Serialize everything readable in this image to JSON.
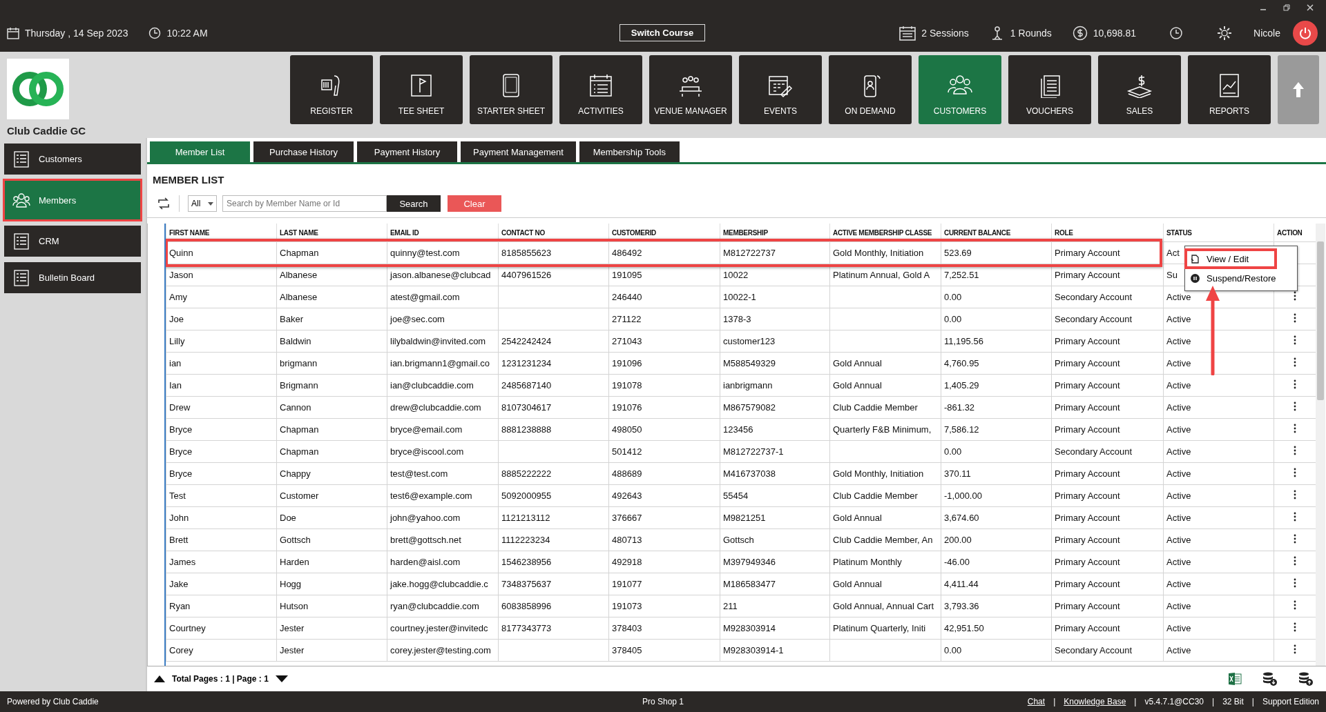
{
  "top_bar": {
    "date": "Thursday ,  14 Sep 2023",
    "time": "10:22 AM",
    "switch_button": "Switch Course",
    "sessions": "2 Sessions",
    "rounds": "1 Rounds",
    "balance": "10,698.81",
    "user": "Nicole"
  },
  "club": {
    "name": "Club Caddie GC"
  },
  "nav_tiles": [
    {
      "label": "REGISTER",
      "selected": false
    },
    {
      "label": "TEE SHEET",
      "selected": false
    },
    {
      "label": "STARTER SHEET",
      "selected": false
    },
    {
      "label": "ACTIVITIES",
      "selected": false
    },
    {
      "label": "VENUE MANAGER",
      "selected": false
    },
    {
      "label": "EVENTS",
      "selected": false
    },
    {
      "label": "ON DEMAND",
      "selected": false
    },
    {
      "label": "CUSTOMERS",
      "selected": true
    },
    {
      "label": "VOUCHERS",
      "selected": false
    },
    {
      "label": "SALES",
      "selected": false
    },
    {
      "label": "REPORTS",
      "selected": false
    }
  ],
  "sidebar": {
    "items": [
      {
        "label": "Customers",
        "selected": false,
        "highlighted": false
      },
      {
        "label": "Members",
        "selected": true,
        "highlighted": true
      },
      {
        "label": "CRM",
        "selected": false,
        "highlighted": false
      },
      {
        "label": "Bulletin Board",
        "selected": false,
        "highlighted": false
      }
    ]
  },
  "tabs": [
    {
      "label": "Member List",
      "selected": true
    },
    {
      "label": "Purchase History",
      "selected": false
    },
    {
      "label": "Payment History",
      "selected": false
    },
    {
      "label": "Payment Management",
      "selected": false
    },
    {
      "label": "Membership Tools",
      "selected": false
    }
  ],
  "page_title": "MEMBER LIST",
  "toolbar": {
    "filter": "All",
    "search": {
      "placeholder": "Search by Member Name or Id"
    },
    "search_button": "Search",
    "clear_button": "Clear"
  },
  "table": {
    "columns": [
      "FIRST NAME",
      "LAST NAME",
      "EMAIL ID",
      "CONTACT NO",
      "CUSTOMERID",
      "MEMBERSHIP",
      "ACTIVE MEMBERSHIP CLASSE",
      "CURRENT BALANCE",
      "ROLE",
      "STATUS",
      "ACTION"
    ],
    "rows": [
      {
        "cells": [
          "Quinn",
          "Chapman",
          "quinny@test.com",
          "8185855623",
          "486492",
          "M812722737",
          "Gold Monthly, Initiation",
          "523.69",
          "Primary Account",
          "Act"
        ],
        "highlighted": true
      },
      {
        "cells": [
          "Jason",
          "Albanese",
          "jason.albanese@clubcad",
          "4407961526",
          "191095",
          "10022",
          "Platinum Annual, Gold A",
          "7,252.51",
          "Primary Account",
          "Su"
        ],
        "highlighted": false
      },
      {
        "cells": [
          "Amy",
          "Albanese",
          "atest@gmail.com",
          "",
          "246440",
          "10022-1",
          "",
          "0.00",
          "Secondary Account",
          "Active"
        ],
        "highlighted": false
      },
      {
        "cells": [
          "Joe",
          "Baker",
          "joe@sec.com",
          "",
          "271122",
          "1378-3",
          "",
          "0.00",
          "Secondary Account",
          "Active"
        ],
        "highlighted": false
      },
      {
        "cells": [
          "Lilly",
          "Baldwin",
          "lilybaldwin@invited.com",
          "2542242424",
          "271043",
          "customer123",
          "",
          "11,195.56",
          "Primary Account",
          "Active"
        ],
        "highlighted": false
      },
      {
        "cells": [
          "ian",
          "brigmann",
          "ian.brigmann1@gmail.co",
          "1231231234",
          "191096",
          "M588549329",
          "Gold Annual",
          "4,760.95",
          "Primary Account",
          "Active"
        ],
        "highlighted": false
      },
      {
        "cells": [
          "Ian",
          "Brigmann",
          "ian@clubcaddie.com",
          "2485687140",
          "191078",
          "ianbrigmann",
          "Gold Annual",
          "1,405.29",
          "Primary Account",
          "Active"
        ],
        "highlighted": false
      },
      {
        "cells": [
          "Drew",
          "Cannon",
          "drew@clubcaddie.com",
          "8107304617",
          "191076",
          "M867579082",
          "Club Caddie Member",
          "-861.32",
          "Primary Account",
          "Active"
        ],
        "highlighted": false
      },
      {
        "cells": [
          "Bryce",
          "Chapman",
          "bryce@email.com",
          "8881238888",
          "498050",
          "123456",
          "Quarterly F&B Minimum,",
          "7,586.12",
          "Primary Account",
          "Active"
        ],
        "highlighted": false
      },
      {
        "cells": [
          "Bryce",
          "Chapman",
          "bryce@iscool.com",
          "",
          "501412",
          "M812722737-1",
          "",
          "0.00",
          "Secondary Account",
          "Active"
        ],
        "highlighted": false
      },
      {
        "cells": [
          "Bryce",
          "Chappy",
          "test@test.com",
          "8885222222",
          "488689",
          "M416737038",
          "Gold Monthly, Initiation",
          "370.11",
          "Primary Account",
          "Active"
        ],
        "highlighted": false
      },
      {
        "cells": [
          "Test",
          "Customer",
          "test6@example.com",
          "5092000955",
          "492643",
          "55454",
          "Club Caddie Member",
          "-1,000.00",
          "Primary Account",
          "Active"
        ],
        "highlighted": false
      },
      {
        "cells": [
          "John",
          "Doe",
          "john@yahoo.com",
          "1121213112",
          "376667",
          "M9821251",
          "Gold Annual",
          "3,674.60",
          "Primary Account",
          "Active"
        ],
        "highlighted": false
      },
      {
        "cells": [
          "Brett",
          "Gottsch",
          "brett@gottsch.net",
          "1112223234",
          "480713",
          "Gottsch",
          "Club Caddie Member, An",
          "200.00",
          "Primary Account",
          "Active"
        ],
        "highlighted": false
      },
      {
        "cells": [
          "James",
          "Harden",
          "harden@aisl.com",
          "1546238956",
          "492918",
          "M397949346",
          "Platinum Monthly",
          "-46.00",
          "Primary Account",
          "Active"
        ],
        "highlighted": false
      },
      {
        "cells": [
          "Jake",
          "Hogg",
          "jake.hogg@clubcaddie.c",
          "7348375637",
          "191077",
          "M186583477",
          "Gold Annual",
          "4,411.44",
          "Primary Account",
          "Active"
        ],
        "highlighted": false
      },
      {
        "cells": [
          "Ryan",
          "Hutson",
          "ryan@clubcaddie.com",
          "6083858996",
          "191073",
          "211",
          "Gold Annual, Annual Cart",
          "3,793.36",
          "Primary Account",
          "Active"
        ],
        "highlighted": false
      },
      {
        "cells": [
          "Courtney",
          "Jester",
          "courtney.jester@invitedc",
          "8177343773",
          "378403",
          "M928303914",
          "Platinum Quarterly, Initi",
          "42,951.50",
          "Primary Account",
          "Active"
        ],
        "highlighted": false
      },
      {
        "cells": [
          "Corey",
          "Jester",
          "corey.jester@testing.com",
          "",
          "378405",
          "M928303914-1",
          "",
          "0.00",
          "Secondary Account",
          "Active"
        ],
        "highlighted": false
      }
    ]
  },
  "action_menu": {
    "items": [
      {
        "label": "View / Edit",
        "highlighted": true
      },
      {
        "label": "Suspend/Restore",
        "highlighted": false
      }
    ]
  },
  "pager": "Total Pages : 1 | Page : 1",
  "status_bar": {
    "left": "Powered by Club Caddie",
    "center": "Pro Shop 1",
    "right": [
      {
        "kind": "link",
        "text": "Chat"
      },
      {
        "kind": "separator",
        "text": "|"
      },
      {
        "kind": "link",
        "text": "Knowledge Base"
      },
      {
        "kind": "separator",
        "text": "|"
      },
      {
        "kind": "text",
        "text": "v5.4.7.1@CC30"
      },
      {
        "kind": "separator",
        "text": "|"
      },
      {
        "kind": "text",
        "text": "32 Bit"
      },
      {
        "kind": "separator",
        "text": "|"
      },
      {
        "kind": "text",
        "text": "Support Edition"
      }
    ]
  }
}
